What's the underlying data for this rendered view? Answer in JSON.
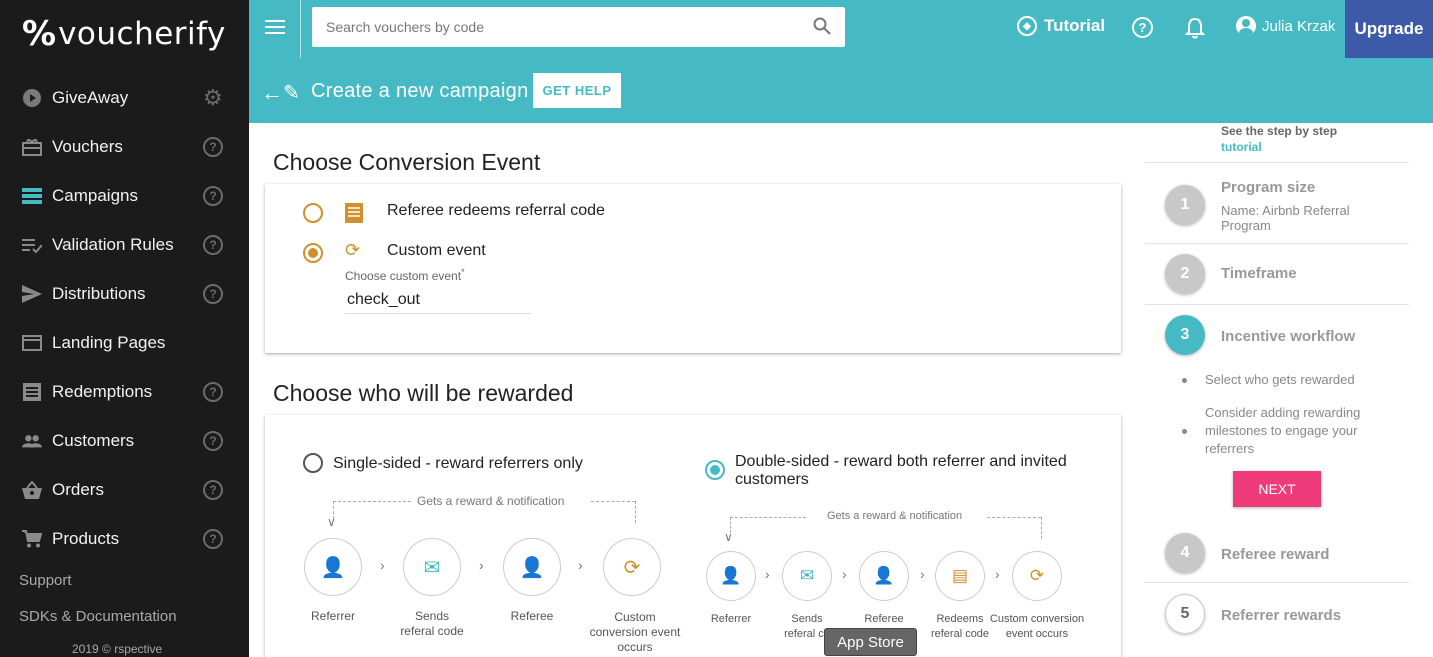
{
  "brand": {
    "mark": "%",
    "name": "voucherify"
  },
  "sidebar": {
    "items": [
      {
        "label": "GiveAway",
        "icon": "play-circle-icon",
        "trail": "gear"
      },
      {
        "label": "Vouchers",
        "icon": "gift-icon",
        "trail": "help"
      },
      {
        "label": "Campaigns",
        "icon": "campaigns-icon",
        "trail": "help"
      },
      {
        "label": "Validation Rules",
        "icon": "checklist-icon",
        "trail": "help"
      },
      {
        "label": "Distributions",
        "icon": "send-icon",
        "trail": "help"
      },
      {
        "label": "Landing Pages",
        "icon": "browser-icon",
        "trail": "none"
      },
      {
        "label": "Redemptions",
        "icon": "receipt-icon",
        "trail": "help"
      },
      {
        "label": "Customers",
        "icon": "people-icon",
        "trail": "help"
      },
      {
        "label": "Orders",
        "icon": "basket-icon",
        "trail": "help"
      },
      {
        "label": "Products",
        "icon": "cart-icon",
        "trail": "help"
      }
    ],
    "support": "Support",
    "sdks": "SDKs & Documentation",
    "footer": "2019 © rspective"
  },
  "header": {
    "search_placeholder": "Search vouchers by code",
    "tutorial": "Tutorial",
    "help": "?",
    "user": "Julia Krzak",
    "upgrade": "Upgrade",
    "title": "Create a new campaign",
    "get_help": "GET HELP"
  },
  "conversion": {
    "title": "Choose Conversion Event",
    "option1": "Referee redeems referral code",
    "option2": "Custom event",
    "field_label": "Choose custom event",
    "field_required": "*",
    "field_value": "check_out"
  },
  "rewarded": {
    "title": "Choose who will be rewarded",
    "single_label": "Single-sided - reward referrers only",
    "double_label_1": "Double-sided - reward both referrer and invited",
    "double_label_2": "customers",
    "single_flow_caption": "Gets a reward & notification",
    "double_flow_caption": "Gets a reward & notification",
    "single_steps": [
      {
        "l1": "Referrer",
        "l2": "",
        "l3": ""
      },
      {
        "l1": "Sends",
        "l2": "referal code",
        "l3": ""
      },
      {
        "l1": "Referee",
        "l2": "",
        "l3": ""
      },
      {
        "l1": "Custom",
        "l2": "conversion event",
        "l3": "occurs"
      }
    ],
    "double_steps": [
      {
        "l1": "Referrer",
        "l2": ""
      },
      {
        "l1": "Sends",
        "l2": "referal co"
      },
      {
        "l1": "Referee",
        "l2": ""
      },
      {
        "l1": "Redeems",
        "l2": "referal code"
      },
      {
        "l1": "Custom conversion",
        "l2": "event occurs"
      }
    ]
  },
  "tooltip": "App Store",
  "steps": {
    "intro_1": "See the step by step",
    "intro_link": "tutorial",
    "s1": {
      "num": "1",
      "title": "Program size",
      "sub": "Name: Airbnb Referral Program"
    },
    "s2": {
      "num": "2",
      "title": "Timeframe"
    },
    "s3": {
      "num": "3",
      "title": "Incentive workflow",
      "bullet1": "Select who gets rewarded",
      "bullet2": "Consider adding rewarding milestones to engage your referrers",
      "next": "NEXT"
    },
    "s4": {
      "num": "4",
      "title": "Referee reward"
    },
    "s5": {
      "num": "5",
      "title": "Referrer rewards"
    }
  }
}
